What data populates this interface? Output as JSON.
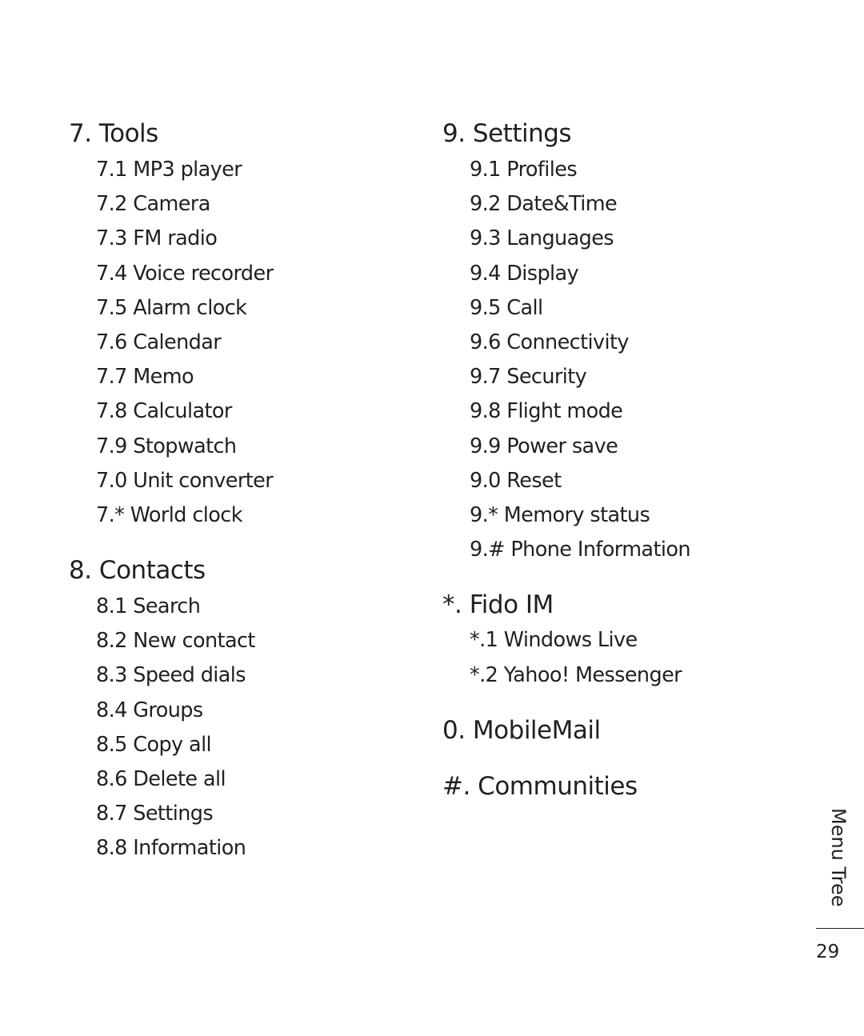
{
  "sections": {
    "tools": {
      "title": "7. Tools",
      "items": [
        "7.1 MP3 player",
        "7.2 Camera",
        "7.3 FM radio",
        "7.4 Voice recorder",
        "7.5 Alarm clock",
        "7.6 Calendar",
        "7.7 Memo",
        "7.8 Calculator",
        "7.9 Stopwatch",
        "7.0 Unit converter",
        "7.* World clock"
      ]
    },
    "contacts": {
      "title": "8. Contacts",
      "items": [
        "8.1 Search",
        "8.2 New contact",
        "8.3 Speed dials",
        "8.4 Groups",
        "8.5 Copy all",
        "8.6 Delete all",
        "8.7 Settings",
        "8.8 Information"
      ]
    },
    "settings": {
      "title": "9. Settings",
      "items": [
        "9.1 Profiles",
        "9.2 Date&Time",
        "9.3 Languages",
        "9.4 Display",
        "9.5 Call",
        "9.6 Connectivity",
        "9.7 Security",
        "9.8 Flight mode",
        "9.9 Power save",
        "9.0 Reset",
        "9.* Memory status",
        "9.# Phone Information"
      ]
    },
    "fido": {
      "title": "*. Fido IM",
      "items": [
        "*.1 Windows Live",
        "*.2 Yahoo! Messenger"
      ]
    },
    "mobilemail": {
      "title": "0. MobileMail"
    },
    "communities": {
      "title": "#. Communities"
    }
  },
  "footer": {
    "section_label": "Menu Tree",
    "page_number": "29"
  }
}
